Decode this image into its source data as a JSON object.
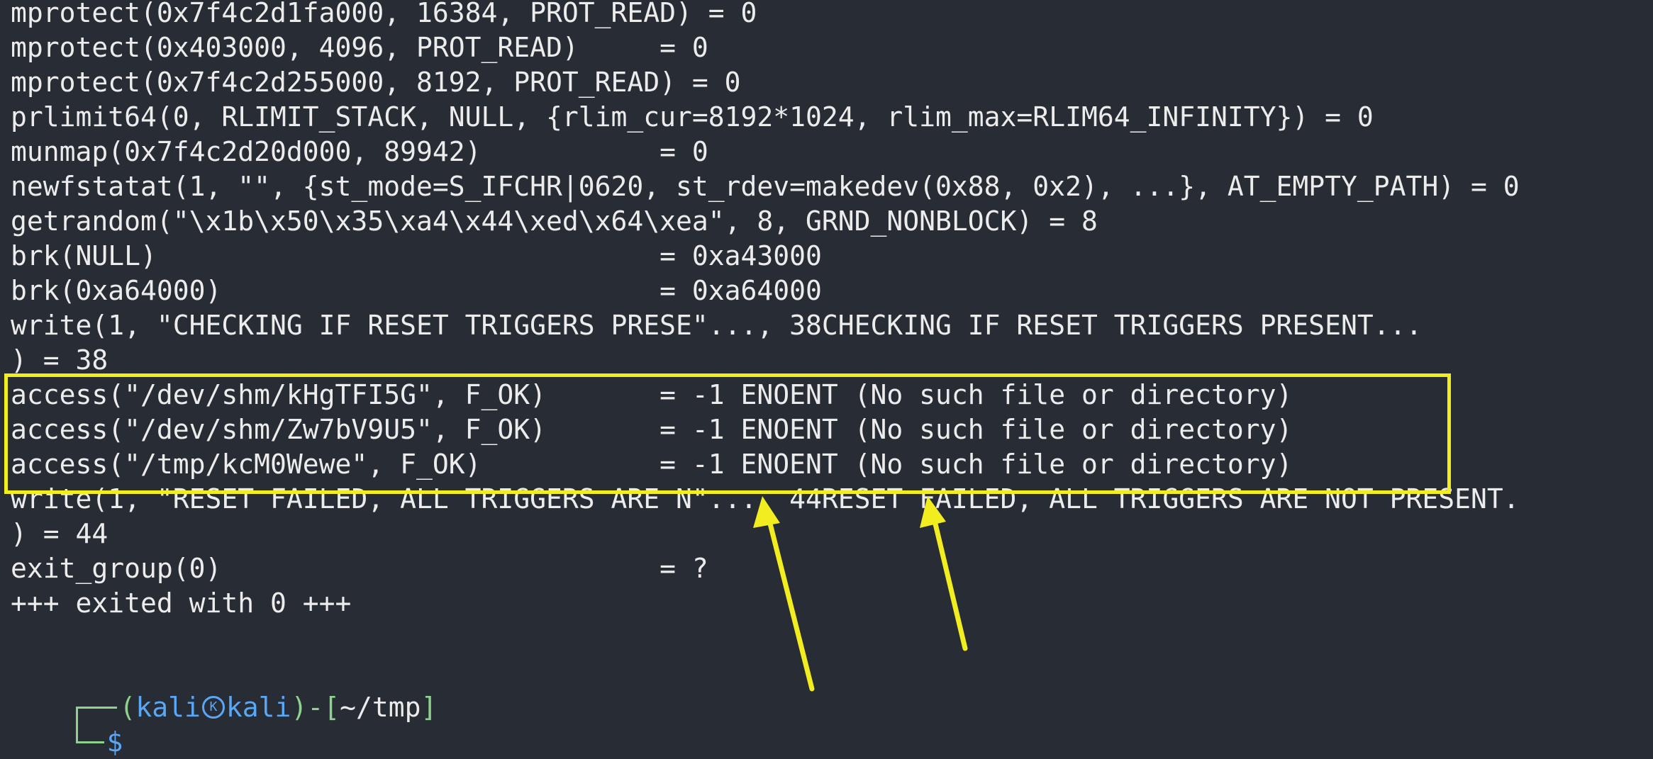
{
  "terminal": {
    "lines": [
      "mprotect(0x7f4c2d1fa000, 16384, PROT_READ) = 0",
      "mprotect(0x403000, 4096, PROT_READ)     = 0",
      "mprotect(0x7f4c2d255000, 8192, PROT_READ) = 0",
      "prlimit64(0, RLIMIT_STACK, NULL, {rlim_cur=8192*1024, rlim_max=RLIM64_INFINITY}) = 0",
      "munmap(0x7f4c2d20d000, 89942)           = 0",
      "newfstatat(1, \"\", {st_mode=S_IFCHR|0620, st_rdev=makedev(0x88, 0x2), ...}, AT_EMPTY_PATH) = 0",
      "getrandom(\"\\x1b\\x50\\x35\\xa4\\x44\\xed\\x64\\xea\", 8, GRND_NONBLOCK) = 8",
      "brk(NULL)                               = 0xa43000",
      "brk(0xa64000)                           = 0xa64000",
      "write(1, \"CHECKING IF RESET TRIGGERS PRESE\"..., 38CHECKING IF RESET TRIGGERS PRESENT...",
      ") = 38",
      "access(\"/dev/shm/kHgTFI5G\", F_OK)       = -1 ENOENT (No such file or directory)",
      "access(\"/dev/shm/Zw7bV9U5\", F_OK)       = -1 ENOENT (No such file or directory)",
      "access(\"/tmp/kcM0Wewe\", F_OK)           = -1 ENOENT (No such file or directory)",
      "write(1, \"RESET FAILED, ALL TRIGGERS ARE N\"..., 44RESET FAILED, ALL TRIGGERS ARE NOT PRESENT.",
      ") = 44",
      "exit_group(0)                           = ?",
      "+++ exited with 0 +++"
    ]
  },
  "prompt": {
    "open_paren": "(",
    "user": "kali",
    "kali_icon_glyph": "K",
    "host": "kali",
    "close_bracket_open": ")-[",
    "cwd": "~/tmp",
    "close_bracket": "]",
    "symbol": "$"
  },
  "annotations": {
    "highlight_color": "#f2ed1f",
    "arrow_color": "#f2ed1f"
  }
}
